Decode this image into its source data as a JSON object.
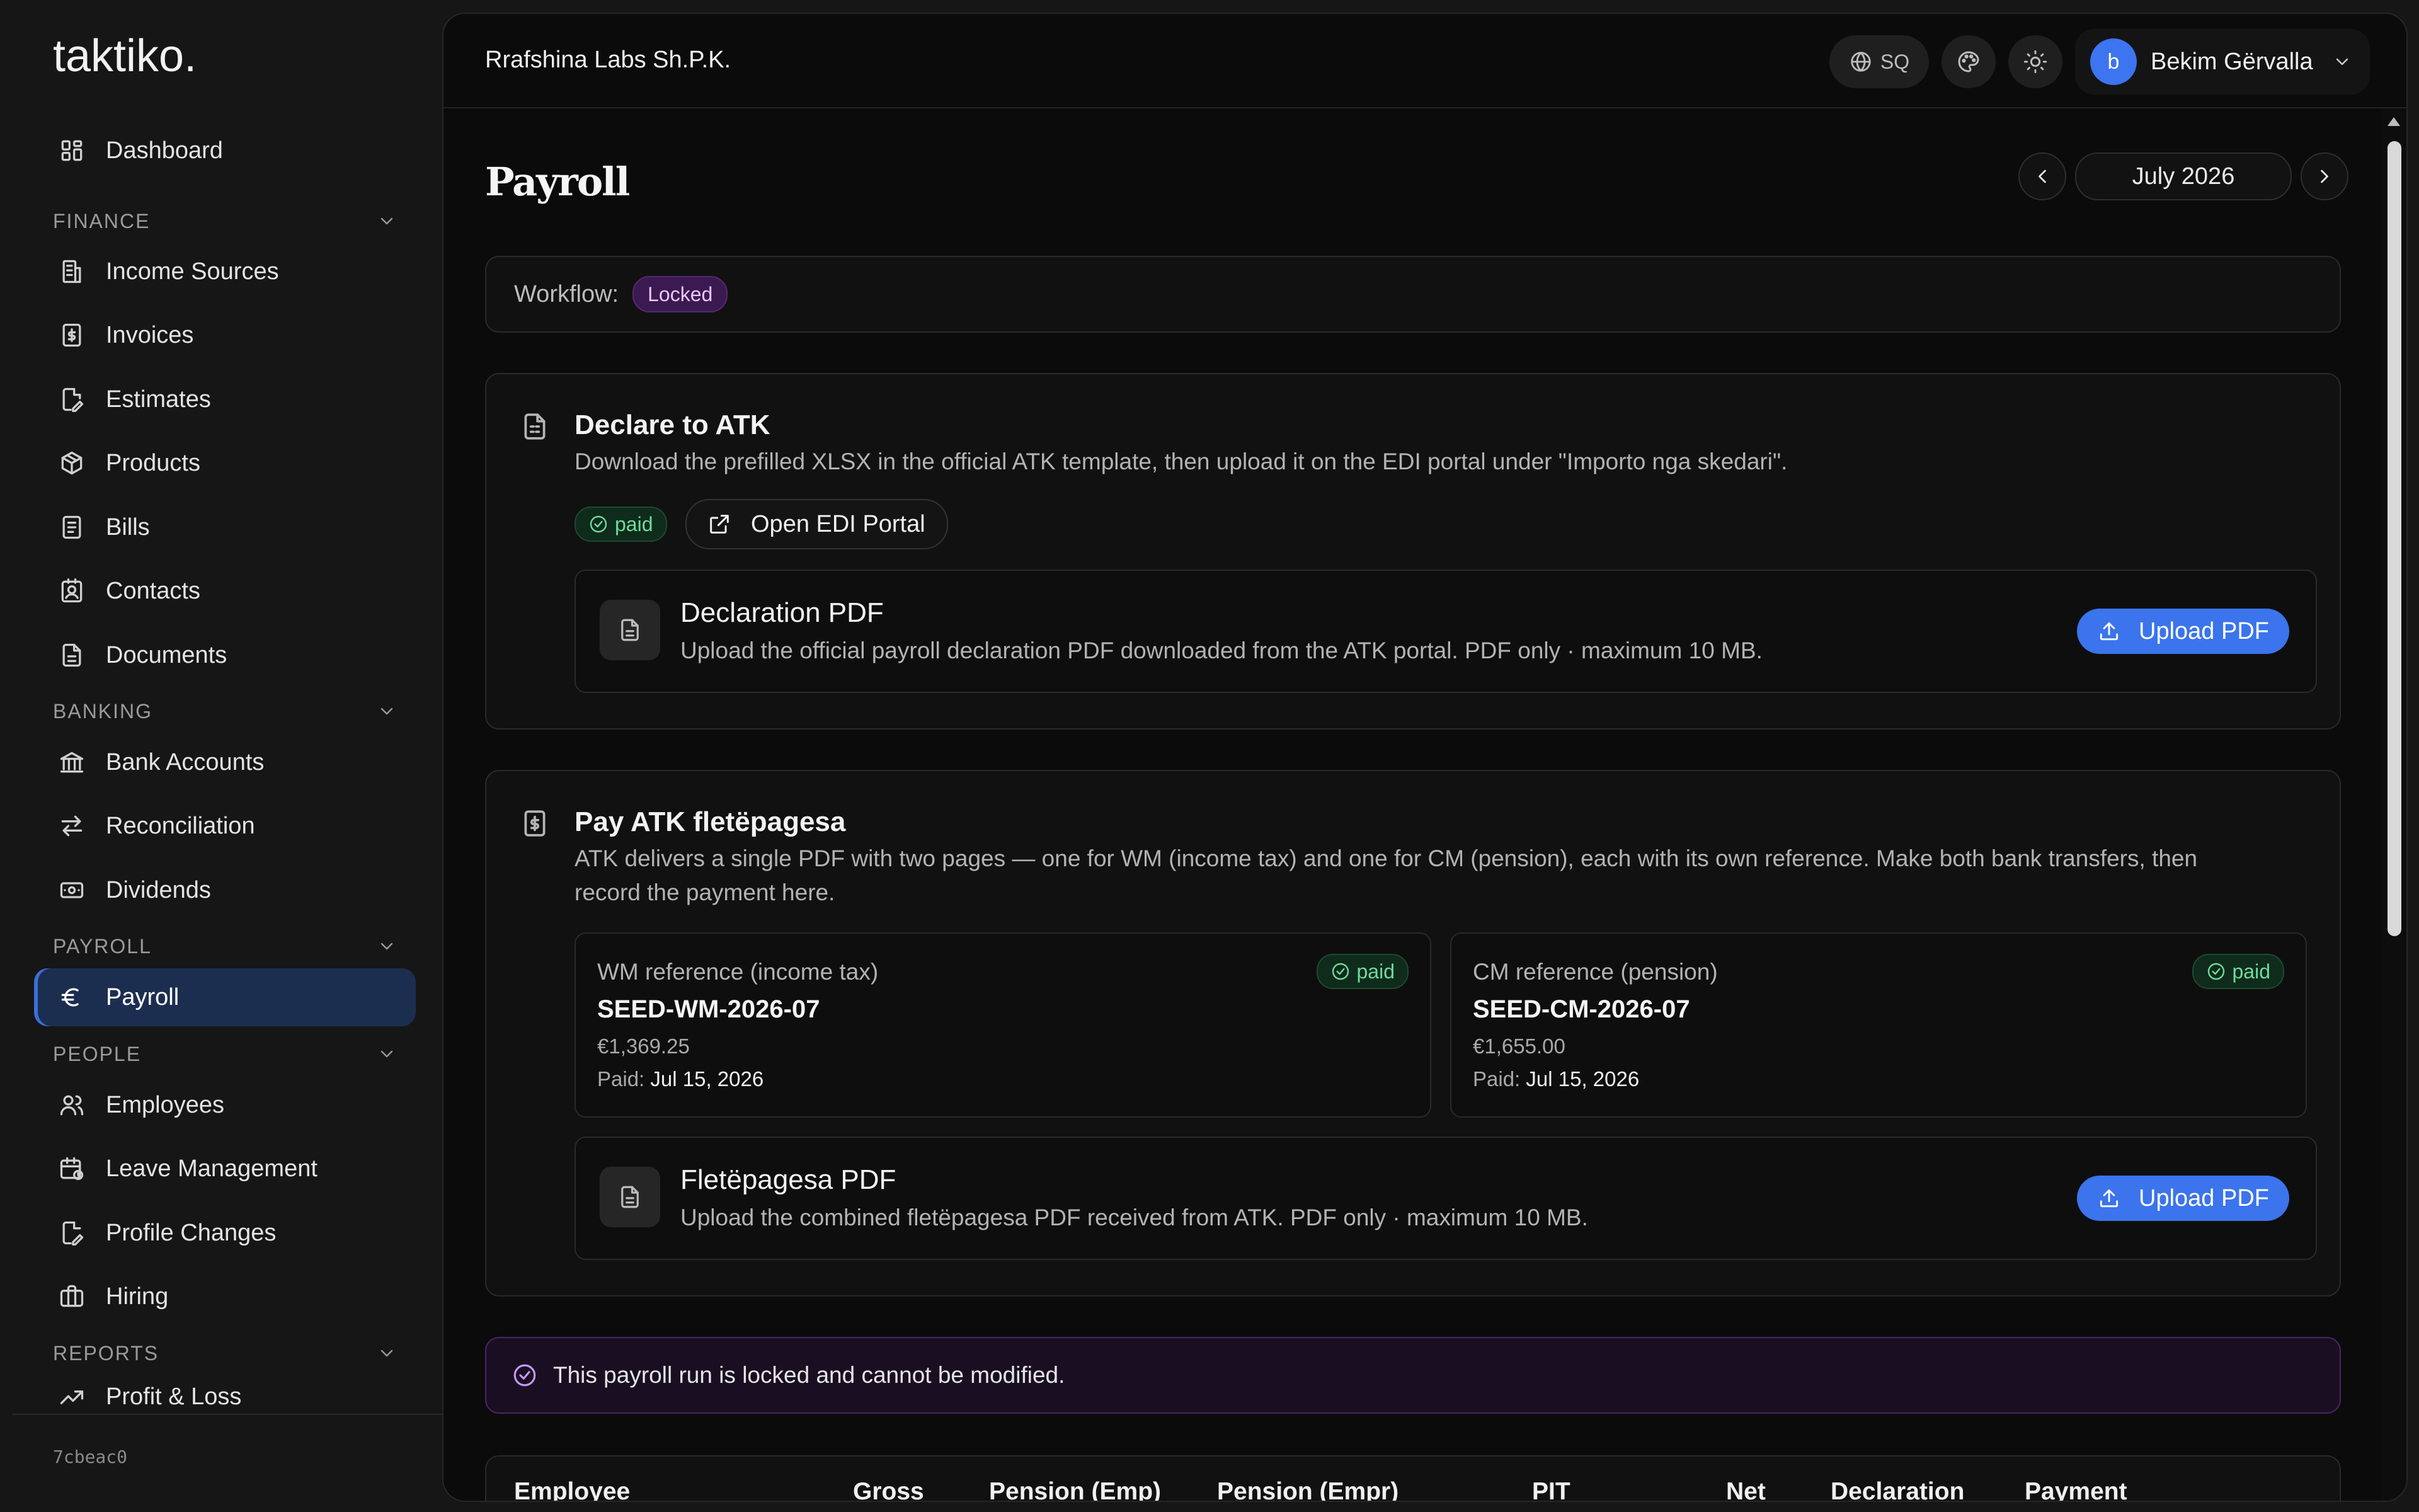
{
  "brand": {
    "logo": "taktiko."
  },
  "sidebar": {
    "dashboard": "Dashboard",
    "sections": {
      "finance": "FINANCE",
      "banking": "BANKING",
      "payroll": "PAYROLL",
      "people": "PEOPLE",
      "reports": "REPORTS"
    },
    "finance_items": [
      "Income Sources",
      "Invoices",
      "Estimates",
      "Products",
      "Bills",
      "Contacts",
      "Documents"
    ],
    "banking_items": [
      "Bank Accounts",
      "Reconciliation",
      "Dividends"
    ],
    "payroll_items": [
      "Payroll"
    ],
    "people_items": [
      "Employees",
      "Leave Management",
      "Profile Changes",
      "Hiring"
    ],
    "reports_items": [
      "Profit & Loss"
    ],
    "version": "7cbeac0",
    "active_item": "Payroll",
    "active_color": "#1c2e50"
  },
  "header": {
    "organization": "Rrafshina Labs Sh.P.K.",
    "language": "SQ",
    "user_initial": "b",
    "user_name": "Bekim Gërvalla",
    "avatar_color": "#3d74f0"
  },
  "page": {
    "title": "Payroll",
    "period": "July 2026"
  },
  "workflow": {
    "label": "Workflow:",
    "status": "Locked"
  },
  "declare": {
    "title": "Declare to ATK",
    "description": "Download the prefilled XLSX in the official ATK template, then upload it on the EDI portal under \"Importo nga skedari\".",
    "status": "paid",
    "open_portal": "Open EDI Portal",
    "pdf": {
      "title": "Declaration PDF",
      "description": "Upload the official payroll declaration PDF downloaded from the ATK portal. PDF only · maximum 10 MB.",
      "button": "Upload PDF"
    }
  },
  "pay": {
    "title": "Pay ATK fletëpagesa",
    "description_line1": "ATK delivers a single PDF with two pages — one for WM (income tax) and one for CM (pension), each with its own reference. Make both bank transfers, then",
    "description_line2": "record the payment here.",
    "wm": {
      "label": "WM reference (income tax)",
      "status": "paid",
      "code": "SEED-WM-2026-07",
      "amount": "€1,369.25",
      "paid_label": "Paid:",
      "paid_date": "Jul 15, 2026"
    },
    "cm": {
      "label": "CM reference (pension)",
      "status": "paid",
      "code": "SEED-CM-2026-07",
      "amount": "€1,655.00",
      "paid_label": "Paid:",
      "paid_date": "Jul 15, 2026"
    },
    "pdf": {
      "title": "Fletëpagesa PDF",
      "description": "Upload the combined fletëpagesa PDF received from ATK. PDF only · maximum 10 MB.",
      "button": "Upload PDF"
    }
  },
  "lock_notice": "This payroll run is locked and cannot be modified.",
  "table": {
    "columns": [
      "Employee",
      "Gross",
      "Pension (Emp)",
      "Pension (Empr)",
      "PIT",
      "Net",
      "Declaration",
      "Payment"
    ]
  },
  "colors": {
    "accent_blue": "#3b74ec",
    "paid_green": "#6fdc9b",
    "locked_purple": "#e9c8ff"
  }
}
